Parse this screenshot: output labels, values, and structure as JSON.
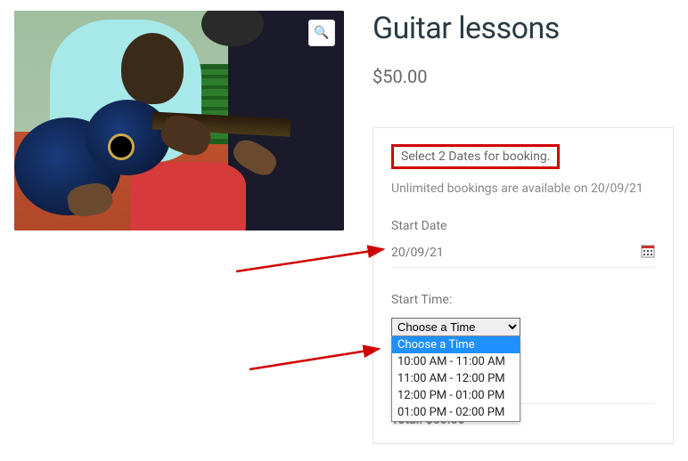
{
  "product": {
    "title": "Guitar lessons",
    "price": "$50.00"
  },
  "booking": {
    "notice": "Select 2 Dates for booking.",
    "availability": "Unlimited bookings are available on 20/09/21",
    "start_date_label": "Start Date",
    "start_date_value": "20/09/21",
    "start_time_label": "Start Time:",
    "time_selected": "Choose a Time",
    "time_options": {
      "placeholder": "Choose a Time",
      "opt1": "10:00 AM - 11:00 AM",
      "opt2": "11:00 AM - 12:00 PM",
      "opt3": "12:00 PM - 01:00 PM",
      "opt4": "01:00 PM - 02:00 PM"
    },
    "total_label": "Total: ",
    "total_value": "$50.00"
  },
  "icons": {
    "zoom": "🔍"
  }
}
